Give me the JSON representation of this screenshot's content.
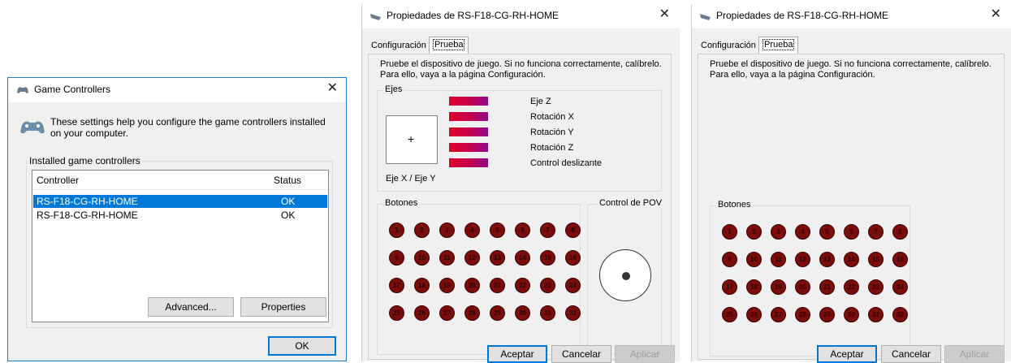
{
  "game_controllers": {
    "title": "Game Controllers",
    "description": "These settings help you configure the game controllers installed on your computer.",
    "installed_label": "Installed game controllers",
    "columns": {
      "controller": "Controller",
      "status": "Status"
    },
    "rows": [
      {
        "controller": "RS-F18-CG-RH-HOME",
        "status": "OK",
        "selected": true
      },
      {
        "controller": "RS-F18-CG-RH-HOME",
        "status": "OK",
        "selected": false
      }
    ],
    "advanced_label": "Advanced...",
    "properties_label": "Properties",
    "ok_label": "OK"
  },
  "properties_full": {
    "title": "Propiedades de RS-F18-CG-RH-HOME",
    "tabs": [
      "Configuración",
      "Prueba"
    ],
    "active_tab": "Prueba",
    "description_line1": "Pruebe el dispositivo de juego. Si no funciona correctamente, calíbrelo.",
    "description_line2": "Para ello, vaya a la página Configuración.",
    "axes_label": "Ejes",
    "xy_label": "Eje X / Eje Y",
    "crosshair": "+",
    "axes": [
      "Eje Z",
      "Rotación X",
      "Rotación Y",
      "Rotación Z",
      "Control deslizante"
    ],
    "buttons_label": "Botones",
    "pov_label": "Control de POV",
    "buttons": [
      "1",
      "2",
      "3",
      "4",
      "5",
      "6",
      "7",
      "8",
      "9",
      "10",
      "11",
      "12",
      "13",
      "14",
      "15",
      "16",
      "17",
      "18",
      "19",
      "20",
      "21",
      "22",
      "23",
      "24",
      "25",
      "26",
      "27",
      "28",
      "29",
      "30",
      "31",
      "32"
    ],
    "accept_label": "Aceptar",
    "cancel_label": "Cancelar",
    "apply_label": "Aplicar"
  },
  "properties_buttons_only": {
    "title": "Propiedades de RS-F18-CG-RH-HOME",
    "tabs": [
      "Configuración",
      "Prueba"
    ],
    "active_tab": "Prueba",
    "description_line1": "Pruebe el dispositivo de juego. Si no funciona correctamente, calíbrelo.",
    "description_line2": "Para ello, vaya a la página Configuración.",
    "buttons_label": "Botones",
    "buttons": [
      "1",
      "2",
      "3",
      "4",
      "5",
      "6",
      "7",
      "8",
      "9",
      "10",
      "11",
      "12",
      "13",
      "14",
      "15",
      "16",
      "17",
      "18",
      "19",
      "20",
      "21",
      "22",
      "23",
      "24",
      "25",
      "26",
      "27",
      "28",
      "29",
      "30",
      "31",
      "32"
    ],
    "accept_label": "Aceptar",
    "cancel_label": "Cancelar",
    "apply_label": "Aplicar"
  },
  "colors": {
    "selection": "#0078d7",
    "joy_button": "#7a0c0c",
    "axis_gradient_start": "#e0002a",
    "axis_gradient_end": "#8e0a8a"
  },
  "icons": {
    "gamepad": "gamepad-icon",
    "close": "close-icon"
  }
}
